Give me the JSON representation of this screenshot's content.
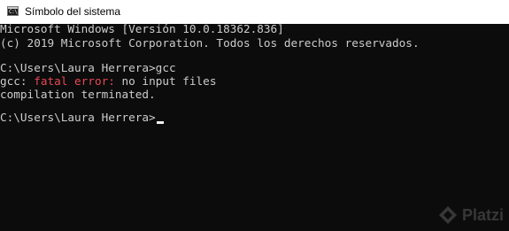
{
  "window": {
    "title": "Símbolo del sistema",
    "icon": "cmd-icon",
    "icon_glyph": "C:\\"
  },
  "console": {
    "lines": [
      {
        "text": "Microsoft Windows [Versión 10.0.18362.836]"
      },
      {
        "text": "(c) 2019 Microsoft Corporation. Todos los derechos reservados."
      },
      {
        "text": ""
      },
      {
        "text": "C:\\Users\\Laura Herrera>gcc"
      },
      {
        "prefix": "gcc: ",
        "error": "fatal error:",
        "suffix": " no input files"
      },
      {
        "text": "compilation terminated."
      },
      {
        "text": ""
      },
      {
        "text": "C:\\Users\\Laura Herrera>"
      }
    ],
    "colors": {
      "background": "#0c0c0c",
      "text": "#cccccc",
      "error": "#e74856",
      "cursor": "#f2f2f2"
    }
  },
  "watermark": {
    "text": "Platzi",
    "icon": "platzi-logo-icon"
  }
}
